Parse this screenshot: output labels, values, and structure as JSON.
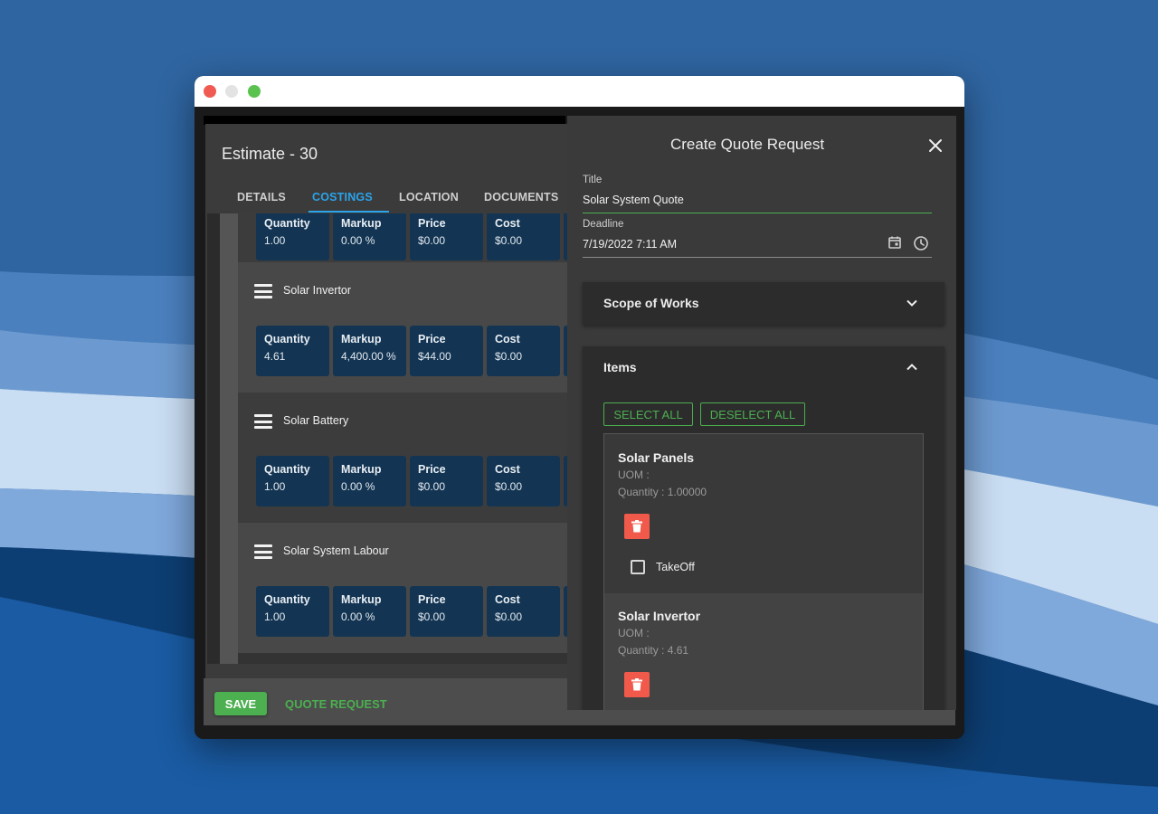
{
  "estimate": {
    "title": "Estimate - 30",
    "tabs": [
      {
        "label": "DETAILS",
        "active": false
      },
      {
        "label": "COSTINGS",
        "active": true
      },
      {
        "label": "LOCATION",
        "active": false
      },
      {
        "label": "DOCUMENTS",
        "active": false
      }
    ],
    "costing_rows": [
      {
        "name": "",
        "quantity": "1.00",
        "markup": "0.00 %",
        "price": "$0.00",
        "cost": "$0.00"
      },
      {
        "name": "Solar Invertor",
        "quantity": "4.61",
        "markup": "4,400.00 %",
        "price": "$44.00",
        "cost": "$0.00"
      },
      {
        "name": "Solar Battery",
        "quantity": "1.00",
        "markup": "0.00 %",
        "price": "$0.00",
        "cost": "$0.00"
      },
      {
        "name": "Solar System Labour",
        "quantity": "1.00",
        "markup": "0.00 %",
        "price": "$0.00",
        "cost": "$0.00"
      }
    ],
    "card_labels": {
      "quantity": "Quantity",
      "markup": "Markup",
      "price": "Price",
      "cost": "Cost"
    },
    "footer": {
      "save_label": "SAVE",
      "quote_request_label": "QUOTE REQUEST"
    }
  },
  "drawer": {
    "title": "Create Quote Request",
    "close_icon": "close-icon",
    "title_field": {
      "label": "Title",
      "value": "Solar System Quote"
    },
    "deadline_field": {
      "label": "Deadline",
      "value": "7/19/2022 7:11 AM"
    },
    "scope_section": {
      "title": "Scope of Works",
      "expanded": false
    },
    "items_section": {
      "title": "Items",
      "expanded": true,
      "select_all_label": "SELECT ALL",
      "deselect_all_label": "DESELECT ALL",
      "items": [
        {
          "name": "Solar Panels",
          "uom": "UOM :",
          "quantity": "Quantity : 1.00000",
          "checkbox_label": "TakeOff"
        },
        {
          "name": "Solar Invertor",
          "uom": "UOM :",
          "quantity": "Quantity : 4.61"
        }
      ]
    }
  },
  "colors": {
    "accent_blue": "#2aa4ec",
    "accent_green": "#4caf50",
    "delete_red": "#f15a4a",
    "card_blue": "#133553"
  }
}
